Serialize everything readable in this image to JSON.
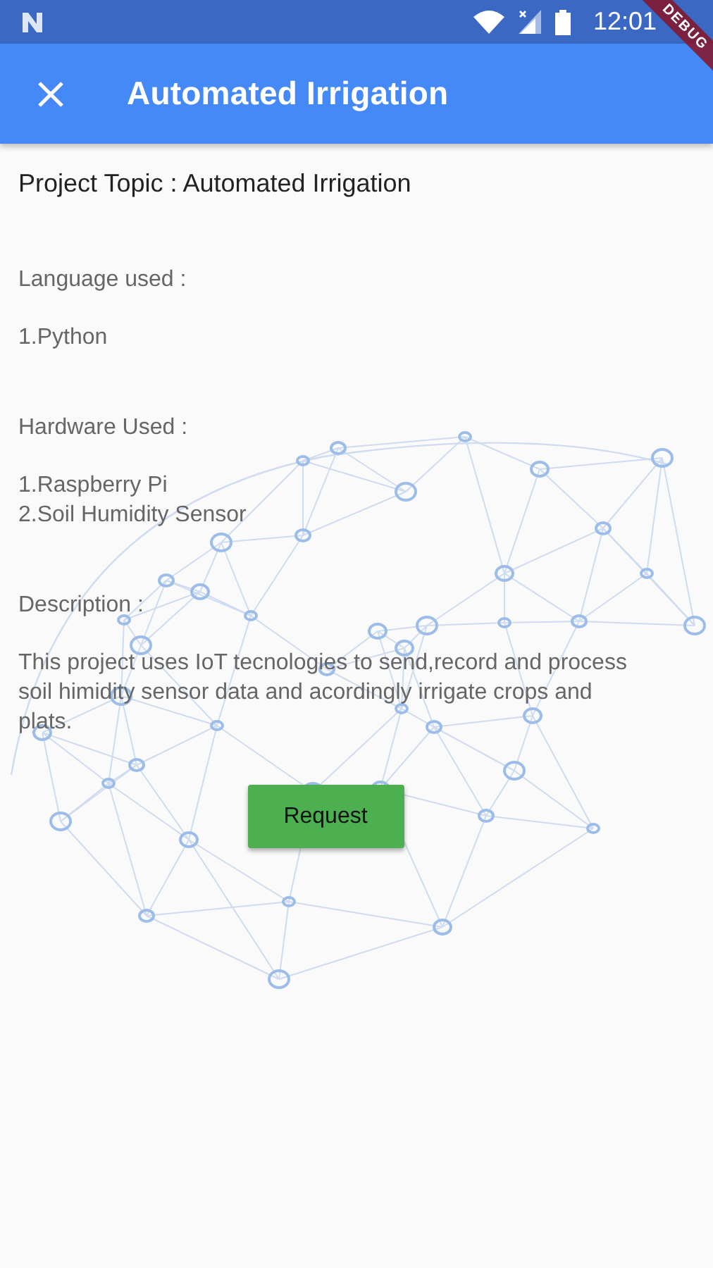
{
  "status_bar": {
    "time": "12:01"
  },
  "debug_banner": "DEBUG",
  "app_bar": {
    "title": "Automated Irrigation"
  },
  "content": {
    "topic": "Project Topic : Automated Irrigation",
    "sections": [
      {
        "heading": "Language used :",
        "lines": [
          "1.Python"
        ]
      },
      {
        "heading": "Hardware Used :",
        "lines": [
          "1.Raspberry Pi",
          "2.Soil Humidity Sensor"
        ]
      },
      {
        "heading": "Description :",
        "lines": [
          "This project uses IoT tecnologies to send,record and process soil himidity sensor data and acordingly irrigate crops and plats."
        ]
      }
    ],
    "button": "Request"
  }
}
